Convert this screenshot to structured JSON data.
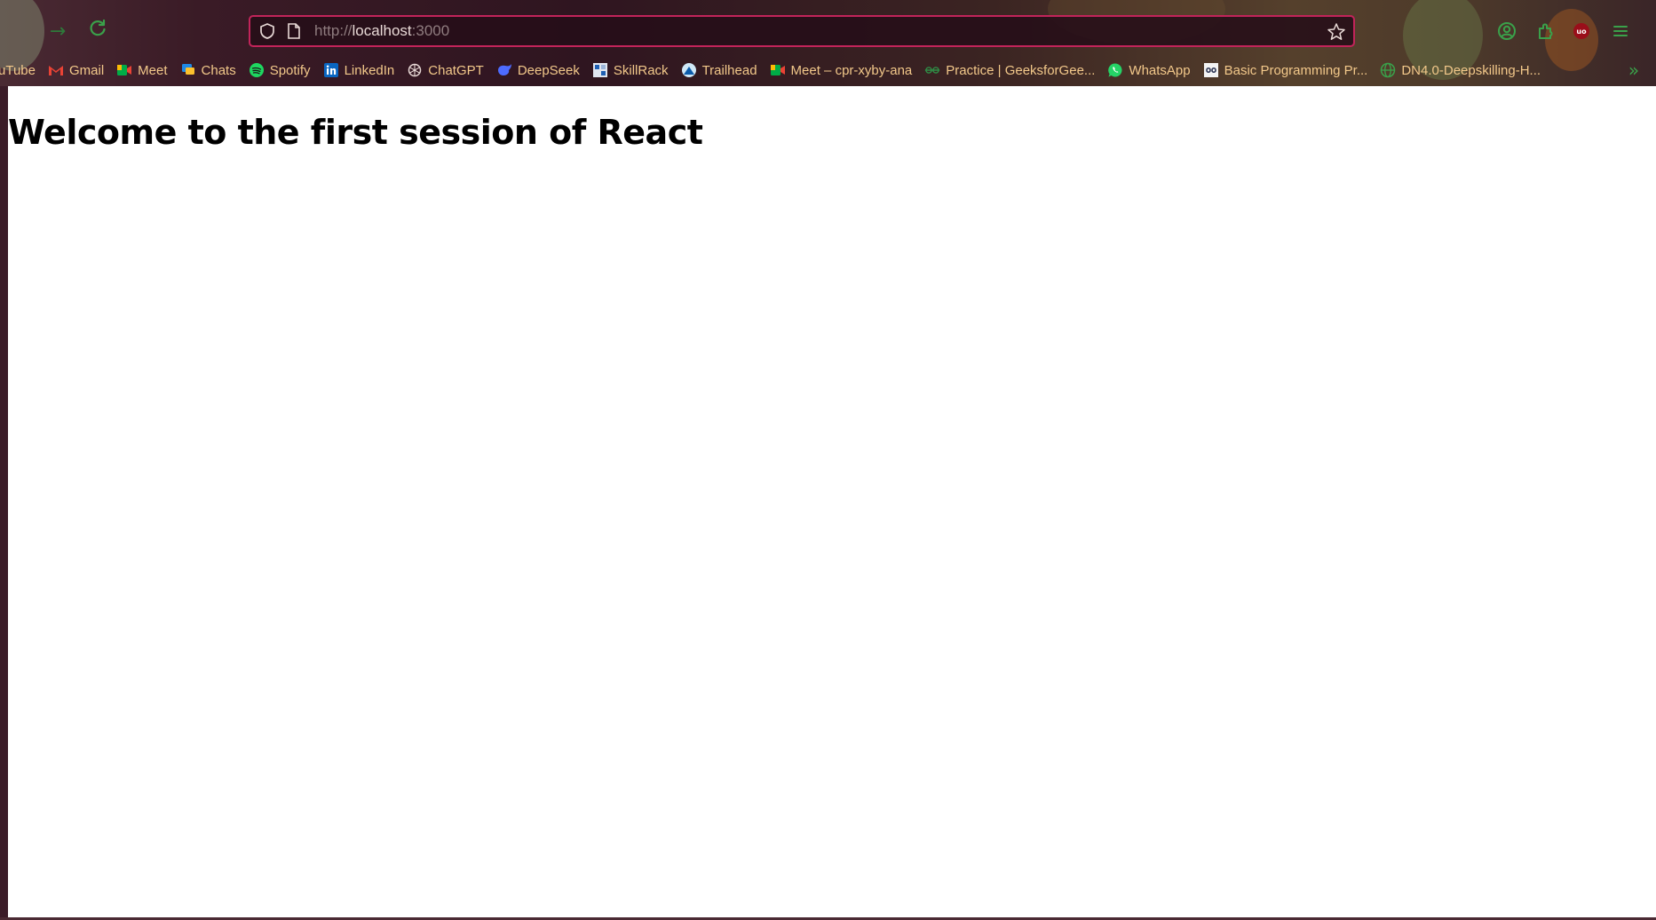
{
  "browser": {
    "url_scheme": "http://",
    "url_host": "localhost",
    "url_port": ":3000",
    "bookmarks": [
      {
        "label": "uTube",
        "icon": "youtube-icon"
      },
      {
        "label": "Gmail",
        "icon": "gmail-icon"
      },
      {
        "label": "Meet",
        "icon": "meet-icon"
      },
      {
        "label": "Chats",
        "icon": "chat-icon"
      },
      {
        "label": "Spotify",
        "icon": "spotify-icon"
      },
      {
        "label": "LinkedIn",
        "icon": "linkedin-icon"
      },
      {
        "label": "ChatGPT",
        "icon": "chatgpt-icon"
      },
      {
        "label": "DeepSeek",
        "icon": "deepseek-icon"
      },
      {
        "label": "SkillRack",
        "icon": "skillrack-icon"
      },
      {
        "label": "Trailhead",
        "icon": "trailhead-icon"
      },
      {
        "label": "Meet – cpr-xyby-ana",
        "icon": "meet-icon"
      },
      {
        "label": "Practice | GeeksforGee...",
        "icon": "geeksforgeeks-icon"
      },
      {
        "label": "WhatsApp",
        "icon": "whatsapp-icon"
      },
      {
        "label": "Basic Programming Pr...",
        "icon": "hackerearth-icon"
      },
      {
        "label": "DN4.0-Deepskilling-H...",
        "icon": "globe-icon"
      }
    ],
    "ublock_badge": "uo"
  },
  "page": {
    "heading": "Welcome to the first session of React"
  },
  "colors": {
    "accent_green": "#3aa14a",
    "urlbar_border": "#c2245a",
    "bookmark_text": "#f2c88a"
  }
}
